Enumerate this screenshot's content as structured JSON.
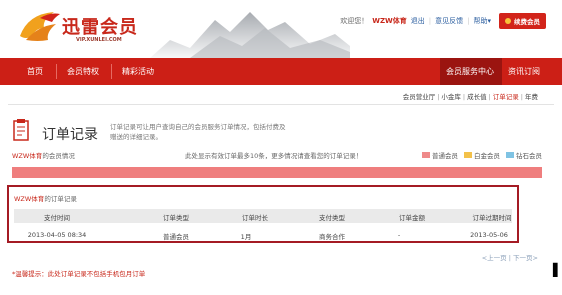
{
  "header": {
    "brand": "迅雷会员",
    "brand_url": "VIP.XUNLEI.COM",
    "greeting": "欢迎您！",
    "username": "WZW体育",
    "logout": "退出",
    "feedback": "意见反馈",
    "help": "帮助",
    "help_arrow": "▾",
    "renew": "续费会员"
  },
  "nav": {
    "left": [
      "首页",
      "会员特权",
      "精彩活动"
    ],
    "right": [
      "会员服务中心",
      "资讯订阅"
    ]
  },
  "subnav": [
    "会员营业厅",
    "小金库",
    "成长值",
    "订单记录",
    "年费"
  ],
  "subnav_active": "订单记录",
  "page": {
    "title": "订单记录",
    "desc": "订单记录可让用户查询自己的会员服务订单情况，包括付费及赠送的详细记录。"
  },
  "member": {
    "username": "WZW体育",
    "suffix": "的会员情况",
    "notice": "此处显示有效订单最多10条，更多情况请查看您的订单记录！",
    "legend": [
      {
        "label": "普通会员",
        "color": "#ef8a8a"
      },
      {
        "label": "白金会员",
        "color": "#f3c14a"
      },
      {
        "label": "钻石会员",
        "color": "#7fc3e3"
      }
    ]
  },
  "orders": {
    "username": "WZW体育",
    "suffix": "的订单记录",
    "columns": [
      "支付时间",
      "订单类型",
      "订单时长",
      "支付类型",
      "订单金额",
      "订单过期时间"
    ],
    "rows": [
      [
        "2013-04-05 08:34",
        "普通会员",
        "1月",
        "商务合作",
        "-",
        "2013-05-06"
      ]
    ]
  },
  "pager": {
    "prev": "<上一页",
    "sep": "|",
    "next": "下一页>"
  },
  "tip": "*温馨提示：此处订单记录不包括手机包月订单",
  "colors": {
    "brand_red": "#cc1f16",
    "box_border": "#a41b24",
    "bar": "#ef7e7e"
  }
}
